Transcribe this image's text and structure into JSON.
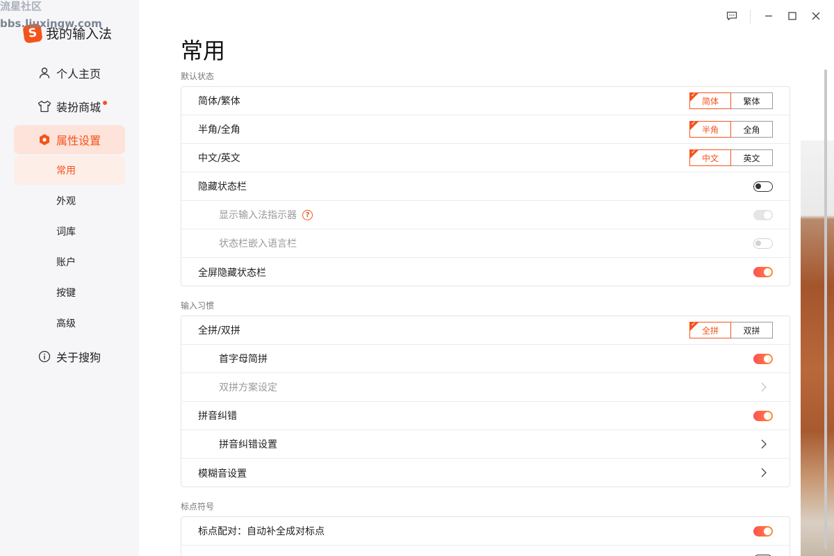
{
  "watermark": {
    "line1": "流星社区",
    "line2": "bbs.liuxingw.com"
  },
  "app": {
    "logo_letter": "S",
    "title": "我的输入法"
  },
  "nav": {
    "profile": "个人主页",
    "store": "装扮商城",
    "settings": "属性设置",
    "about": "关于搜狗",
    "sub": [
      "常用",
      "外观",
      "词库",
      "账户",
      "按键",
      "高级"
    ]
  },
  "page": {
    "title": "常用"
  },
  "sections": {
    "default_state": {
      "label": "默认状态",
      "rows": {
        "simp_trad": {
          "label": "简体/繁体",
          "options": [
            "简体",
            "繁体"
          ],
          "selected": "简体"
        },
        "half_full": {
          "label": "半角/全角",
          "options": [
            "半角",
            "全角"
          ],
          "selected": "半角"
        },
        "cn_en": {
          "label": "中文/英文",
          "options": [
            "中文",
            "英文"
          ],
          "selected": "中文"
        },
        "hide_status": {
          "label": "隐藏状态栏",
          "value": "off"
        },
        "show_indicator": {
          "label": "显示输入法指示器",
          "value": "on-disabled"
        },
        "embed_lang": {
          "label": "状态栏嵌入语言栏",
          "value": "off-disabled"
        },
        "fullscreen_hide": {
          "label": "全屏隐藏状态栏",
          "value": "on"
        }
      }
    },
    "input_habit": {
      "label": "输入习惯",
      "rows": {
        "quanpin": {
          "label": "全拼/双拼",
          "options": [
            "全拼",
            "双拼"
          ],
          "selected": "全拼"
        },
        "initials": {
          "label": "首字母简拼",
          "value": "on"
        },
        "shuangpin_scheme": {
          "label": "双拼方案设定"
        },
        "pinyin_correct": {
          "label": "拼音纠错",
          "value": "on"
        },
        "pinyin_correct_settings": {
          "label": "拼音纠错设置"
        },
        "fuzzy": {
          "label": "模糊音设置"
        }
      }
    },
    "punctuation": {
      "label": "标点符号",
      "rows": {
        "pairing": {
          "label": "标点配对：自动补全成对标点",
          "value": "on"
        }
      }
    }
  },
  "colors": {
    "accent": "#f4531c",
    "toggle_on_start": "#ff4f5a",
    "toggle_on_end": "#ff8c2e"
  },
  "icons": [
    "user-icon",
    "shirt-icon",
    "settings-hex-icon",
    "info-icon",
    "feedback-icon",
    "minimize-icon",
    "maximize-icon",
    "close-icon",
    "help-icon",
    "chevron-right-icon",
    "checkmark-icon"
  ]
}
